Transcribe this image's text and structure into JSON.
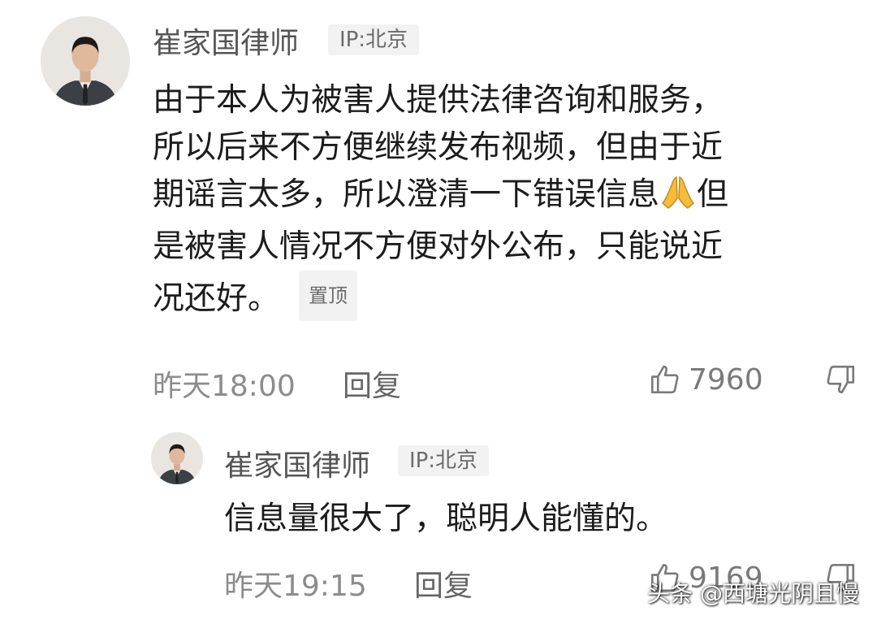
{
  "comments": [
    {
      "author": "崔家国律师",
      "ip": "IP:北京",
      "text_before_emoji": "由于本人为被害人提供法律咨询和服务，\n所以后来不方便继续发布视频，但由于近\n期谣言太多，所以澄清一下错误信息",
      "emoji": "🙏",
      "text_after_emoji": "但\n是被害人情况不方便对外公布，只能说近\n况还好。",
      "pinned_label": "置顶",
      "time": "昨天18:00",
      "reply_label": "回复",
      "like_count": "7960"
    },
    {
      "author": "崔家国律师",
      "ip": "IP:北京",
      "text": "信息量很大了，聪明人能懂的。",
      "time": "昨天19:15",
      "reply_label": "回复",
      "like_count": "9169"
    }
  ],
  "watermark": "头条 @西塘光阴且慢",
  "icons": {
    "like": "thumbs-up-outline-icon",
    "dislike": "thumbs-down-outline-icon"
  },
  "colors": {
    "text_primary": "#1c1c1c",
    "text_secondary": "#8c8c8c",
    "tag_bg": "#f2f2f2"
  }
}
